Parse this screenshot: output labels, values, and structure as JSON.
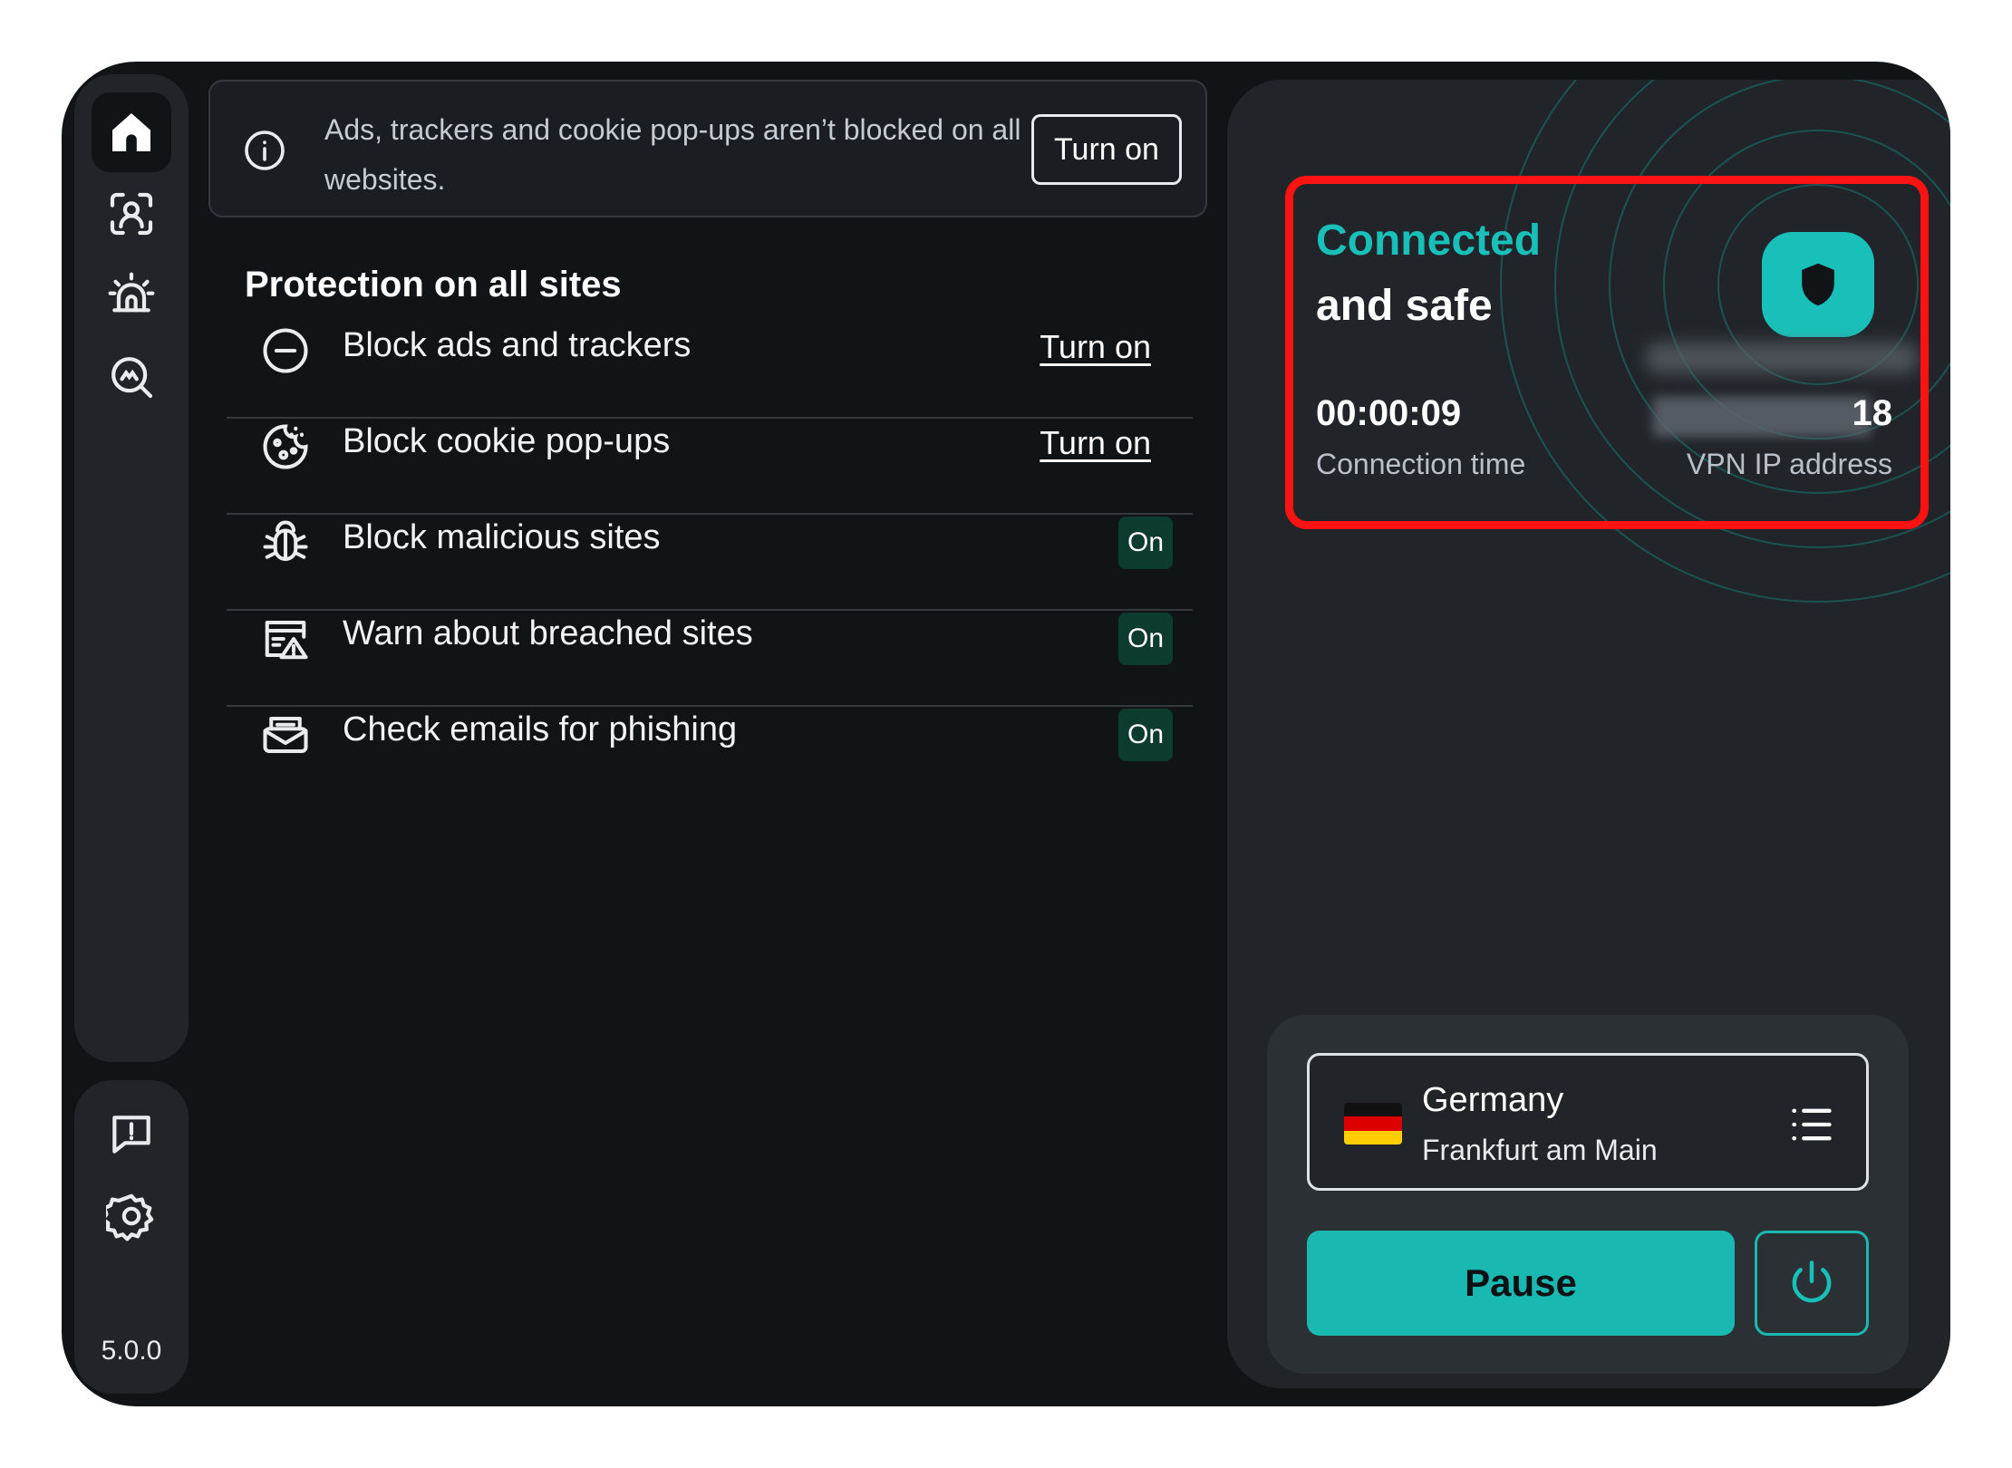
{
  "sidebar": {
    "nav": [
      {
        "icon": "home-icon"
      },
      {
        "icon": "identity-scan-icon"
      },
      {
        "icon": "alarm-icon"
      },
      {
        "icon": "search-scan-icon"
      }
    ],
    "bottom": [
      {
        "icon": "feedback-icon"
      },
      {
        "icon": "gear-icon"
      }
    ],
    "version": "5.0.0"
  },
  "banner": {
    "text": "Ads, trackers and cookie pop-ups aren’t blocked on all websites.",
    "button_label": "Turn on"
  },
  "protection": {
    "title": "Protection on all sites",
    "items": [
      {
        "label": "Block ads and trackers",
        "action": "Turn on",
        "icon": "minus-circle-icon"
      },
      {
        "label": "Block cookie pop-ups",
        "action": "Turn on",
        "icon": "cookie-icon"
      },
      {
        "label": "Block malicious sites",
        "status": "On",
        "icon": "bug-icon"
      },
      {
        "label": "Warn about breached sites",
        "status": "On",
        "icon": "breach-warning-icon"
      },
      {
        "label": "Check emails for phishing",
        "status": "On",
        "icon": "mail-icon"
      }
    ]
  },
  "vpn": {
    "status_line1": "Connected",
    "status_line2": "and safe",
    "connection_time": "00:00:09",
    "connection_time_label": "Connection time",
    "ip_suffix": "18",
    "ip_label": "VPN IP address",
    "location": {
      "country": "Germany",
      "city": "Frankfurt am Main"
    },
    "pause_label": "Pause"
  },
  "colors": {
    "accent": "#19c0ba",
    "highlight": "#ff1212",
    "background": "#111417",
    "panel": "#212529",
    "on_badge": "#0d3b2e"
  }
}
